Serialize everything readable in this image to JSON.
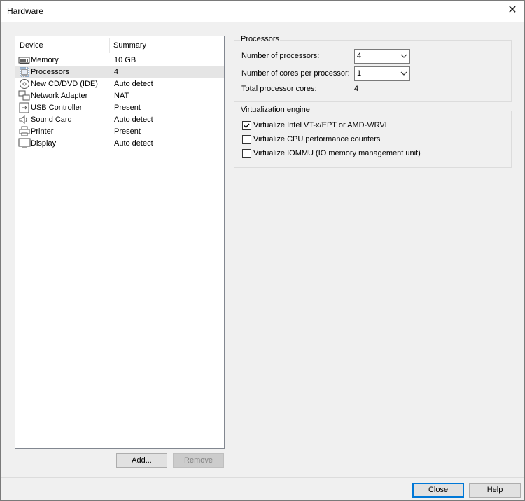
{
  "window": {
    "title": "Hardware"
  },
  "device_list": {
    "columns": {
      "device": "Device",
      "summary": "Summary"
    },
    "rows": [
      {
        "device": "Memory",
        "summary": "10 GB",
        "icon": "memory-icon"
      },
      {
        "device": "Processors",
        "summary": "4",
        "icon": "processor-icon",
        "selected": true
      },
      {
        "device": "New CD/DVD (IDE)",
        "summary": "Auto detect",
        "icon": "cd-dvd-icon"
      },
      {
        "device": "Network Adapter",
        "summary": "NAT",
        "icon": "network-adapter-icon"
      },
      {
        "device": "USB Controller",
        "summary": "Present",
        "icon": "usb-icon"
      },
      {
        "device": "Sound Card",
        "summary": "Auto detect",
        "icon": "speaker-icon"
      },
      {
        "device": "Printer",
        "summary": "Present",
        "icon": "printer-icon"
      },
      {
        "device": "Display",
        "summary": "Auto detect",
        "icon": "monitor-icon"
      }
    ]
  },
  "buttons": {
    "add": "Add...",
    "remove": "Remove",
    "close": "Close",
    "help": "Help"
  },
  "processors": {
    "group_title": "Processors",
    "num_processors_label": "Number of processors:",
    "num_processors_value": "4",
    "cores_label": "Number of cores per processor:",
    "cores_value": "1",
    "total_label": "Total processor cores:",
    "total_value": "4"
  },
  "virtualization": {
    "group_title": "Virtualization engine",
    "options": [
      {
        "label": "Virtualize Intel VT-x/EPT or AMD-V/RVI",
        "checked": true
      },
      {
        "label": "Virtualize CPU performance counters",
        "checked": false
      },
      {
        "label": "Virtualize IOMMU (IO memory management unit)",
        "checked": false
      }
    ]
  },
  "colors": {
    "accent": "#0078d7",
    "selected_row": "#e5e5e5"
  }
}
